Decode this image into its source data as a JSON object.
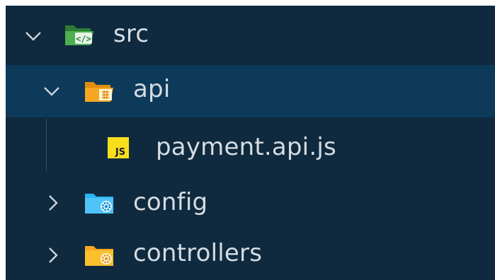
{
  "explorer": {
    "items": [
      {
        "label": "src",
        "state": "expanded",
        "icon": "folder-src-open-icon",
        "color": "#4caf50"
      },
      {
        "label": "api",
        "state": "expanded",
        "icon": "folder-api-open-icon",
        "color": "#f5a623",
        "selected": true
      },
      {
        "label": "payment.api.js",
        "state": "file",
        "icon": "javascript-file-icon",
        "badge": "JS",
        "color": "#f7df1e"
      },
      {
        "label": "config",
        "state": "collapsed",
        "icon": "folder-config-icon",
        "color": "#29b6f6"
      },
      {
        "label": "controllers",
        "state": "collapsed",
        "icon": "folder-controllers-icon",
        "color": "#fbc02d"
      }
    ]
  },
  "colors": {
    "background": "#0f2a3f",
    "selected_row": "#0e3a5a",
    "text": "#d4dce3"
  }
}
